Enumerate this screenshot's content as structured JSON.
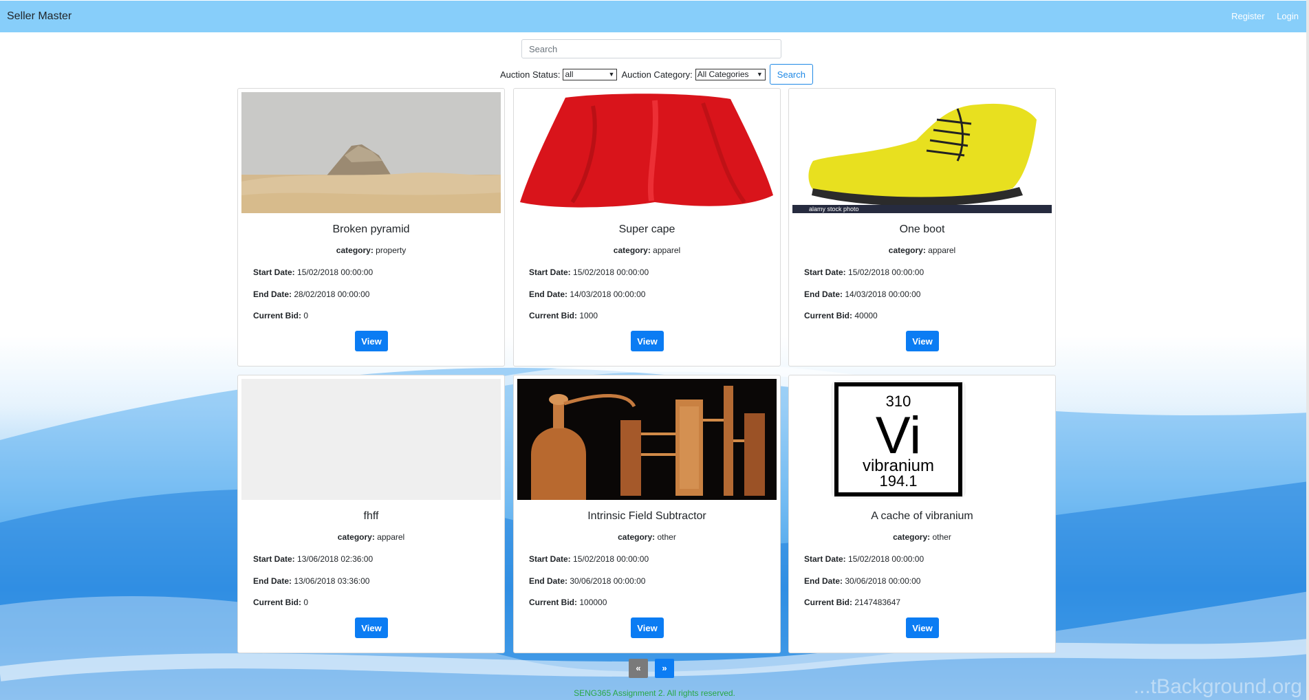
{
  "navbar": {
    "brand": "Seller Master",
    "links": [
      "Register",
      "Login"
    ]
  },
  "search": {
    "placeholder": "Search"
  },
  "filters": {
    "status_label": "Auction Status:",
    "status_value": "all",
    "category_label": "Auction Category:",
    "category_value": "All Categories",
    "search_button": "Search"
  },
  "labels": {
    "category": "category:",
    "start": "Start Date:",
    "end": "End Date:",
    "bid": "Current Bid:",
    "view": "View"
  },
  "auctions": [
    {
      "title": "Broken pyramid",
      "category": "property",
      "start": "15/02/2018 00:00:00",
      "end": "28/02/2018 00:00:00",
      "bid": "0",
      "image": "pyramid-photo"
    },
    {
      "title": "Super cape",
      "category": "apparel",
      "start": "15/02/2018 00:00:00",
      "end": "14/03/2018 00:00:00",
      "bid": "1000",
      "image": "red-cape-photo"
    },
    {
      "title": "One boot",
      "category": "apparel",
      "start": "15/02/2018 00:00:00",
      "end": "14/03/2018 00:00:00",
      "bid": "40000",
      "image": "yellow-boot-photo",
      "image_caption": "alamy stock photo"
    },
    {
      "title": "fhff",
      "category": "apparel",
      "start": "13/06/2018 02:36:00",
      "end": "13/06/2018 03:36:00",
      "bid": "0",
      "image": "empty-placeholder"
    },
    {
      "title": "Intrinsic Field Subtractor",
      "category": "other",
      "start": "15/02/2018 00:00:00",
      "end": "30/06/2018 00:00:00",
      "bid": "100000",
      "image": "copper-still-photo"
    },
    {
      "title": "A cache of vibranium",
      "category": "other",
      "start": "15/02/2018 00:00:00",
      "end": "30/06/2018 00:00:00",
      "bid": "2147483647",
      "image": "vibranium-element-tile",
      "element": {
        "number": "310",
        "symbol": "Vi",
        "name": "vibranium",
        "mass": "194.1"
      }
    }
  ],
  "pagination": {
    "prev": "«",
    "next": "»"
  },
  "footer": "SENG365 Assignment 2. All rights reserved.",
  "watermark": "...tBackground.org",
  "colors": {
    "navbar": "#87cefa",
    "primary": "#0b7cf3",
    "footer_text": "#28a745"
  }
}
